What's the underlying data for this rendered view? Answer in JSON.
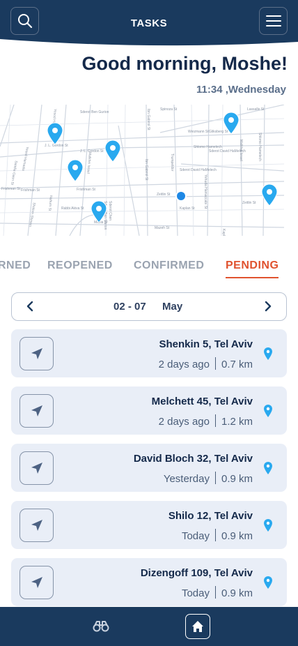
{
  "header": {
    "title": "TASKS",
    "search_icon": "search-icon",
    "menu_icon": "hamburger-menu-icon",
    "bg_color": "#1a3a5e"
  },
  "greeting": "Good morning, Moshe!",
  "time": "11:34 ,Wednesday",
  "map": {
    "streets": [
      "Kaplan St",
      "Saadia Gaon St",
      "Yesod Hamaala",
      "Shalom Shimon",
      "J. L. Gordon St",
      "Frishman St",
      "Mazeh St",
      "Rabbi Akiva St",
      "Malkhei Israel",
      "Nahum St",
      "Sderot Ben Gurion",
      "Sderot Chen",
      "Ibn Gabirol St",
      "Sderot David HaMelech",
      "Gliksberg St",
      "Mazia St",
      "Zeitlin St",
      "Trumpeldor",
      "Weizmann St",
      "Shlomo Hamelech",
      "Spinoza St",
      "Lassalle St",
      "Yehuda Hamaccabi St"
    ],
    "accent_color": "#29a9ef"
  },
  "tabs": [
    {
      "label": "RNED",
      "active": false
    },
    {
      "label": "REOPENED",
      "active": false
    },
    {
      "label": "CONFIRMED",
      "active": false
    },
    {
      "label": "PENDING",
      "active": true
    }
  ],
  "date_selector": {
    "range": "02 - 07",
    "month": "May",
    "prev_icon": "chevron-left-icon",
    "next_icon": "chevron-right-icon"
  },
  "tasks": [
    {
      "address": "Shenkin 5, Tel Aviv",
      "when": "2 days ago",
      "distance": "0.7 km"
    },
    {
      "address": "Melchett 45, Tel Aviv",
      "when": "2 days ago",
      "distance": "1.2 km"
    },
    {
      "address": "David Bloch 32, Tel Aviv",
      "when": "Yesterday",
      "distance": "0.9 km"
    },
    {
      "address": "Shilo 12, Tel Aviv",
      "when": "Today",
      "distance": "0.9 km"
    },
    {
      "address": "Dizengoff 109, Tel Aviv",
      "when": "Today",
      "distance": "0.9 km"
    }
  ],
  "bottom_nav": {
    "left_icon": "binoculars-icon",
    "right_icon": "home-icon"
  },
  "colors": {
    "primary": "#1a3a5e",
    "active_tab": "#e0532f",
    "card_bg": "#e9eef7",
    "pin": "#29a9ef"
  }
}
